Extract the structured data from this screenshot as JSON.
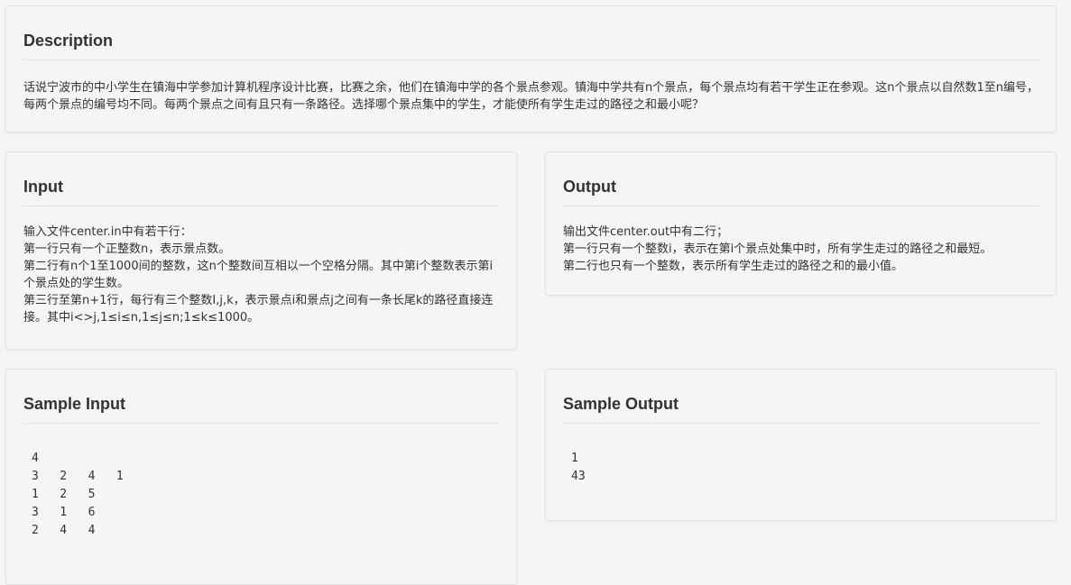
{
  "description": {
    "title": "Description",
    "text": "话说宁波市的中小学生在镇海中学参加计算机程序设计比赛，比赛之余，他们在镇海中学的各个景点参观。镇海中学共有n个景点，每个景点均有若干学生正在参观。这n个景点以自然数1至n编号，每两个景点的编号均不同。每两个景点之间有且只有一条路径。选择哪个景点集中的学生，才能使所有学生走过的路径之和最小呢？"
  },
  "input": {
    "title": "Input",
    "lines": [
      "输入文件center.in中有若干行：",
      "第一行只有一个正整数n，表示景点数。",
      "第二行有n个1至1000间的整数，这n个整数间互相以一个空格分隔。其中第i个整数表示第i个景点处的学生数。",
      "第三行至第n+1行，每行有三个整数I,j,k，表示景点i和景点j之间有一条长尾k的路径直接连接。其中i<>j,1≤i≤n,1≤j≤n;1≤k≤1000。"
    ]
  },
  "output": {
    "title": "Output",
    "lines": [
      "输出文件center.out中有二行；",
      "第一行只有一个整数i，表示在第i个景点处集中时，所有学生走过的路径之和最短。",
      "第二行也只有一个整数，表示所有学生走过的路径之和的最小值。"
    ]
  },
  "sample_input": {
    "title": "Sample Input",
    "content": "4\n3   2   4   1\n1   2   5\n3   1   6\n2   4   4"
  },
  "sample_output": {
    "title": "Sample Output",
    "content": "1\n43"
  }
}
